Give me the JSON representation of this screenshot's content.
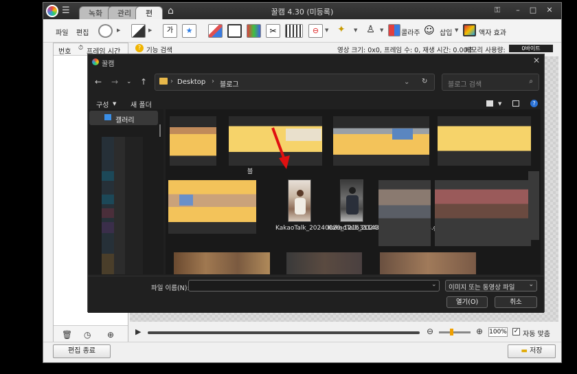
{
  "app": {
    "title": "꿀캠 4.30 (미등록)",
    "tabs": [
      {
        "label": "녹화"
      },
      {
        "label": "관리"
      },
      {
        "label": "편집"
      }
    ],
    "window_controls": {
      "minimize": "–",
      "maximize": "□",
      "close": "✕"
    }
  },
  "toolbar": {
    "file": "파일",
    "edit": "편집",
    "collage": "콜라주",
    "insert": "삽입",
    "frame_effect": "액자 효과"
  },
  "left_panel": {
    "col_number": "번호",
    "col_frame_time": "프레임 시간"
  },
  "statusbar": {
    "feature_search": "기능 검색",
    "info": "영상 크기: 0x0, 프레임 수: 0, 재생 시간: 0.00초",
    "memory_label": "메모리 사용량:",
    "memory_value": "0바이트"
  },
  "playbar": {
    "zoom": "100%",
    "auto_fit": "자동 맞춤"
  },
  "bottom": {
    "end_edit": "편집 종료",
    "save": "저장"
  },
  "dialog": {
    "title": "꿀캠",
    "breadcrumb": [
      "Desktop",
      "블로그"
    ],
    "search_placeholder": "블로그 검색",
    "organize": "구성",
    "new_folder": "새 폴더",
    "nav_gallery": "갤러리",
    "folder_label": "블",
    "files": [
      {
        "name": "KakaoTalk_20240829_121531143.gif"
      },
      {
        "name": "KakaoTalk_20240829_121533828.gif"
      }
    ],
    "filename_label": "파일 이름(N):",
    "filename_value": "",
    "filetype": "이미지 또는 동영상 파일",
    "open_button": "열기(O)",
    "cancel_button": "취소"
  },
  "annotation": {
    "arrow_color": "#e01010"
  }
}
